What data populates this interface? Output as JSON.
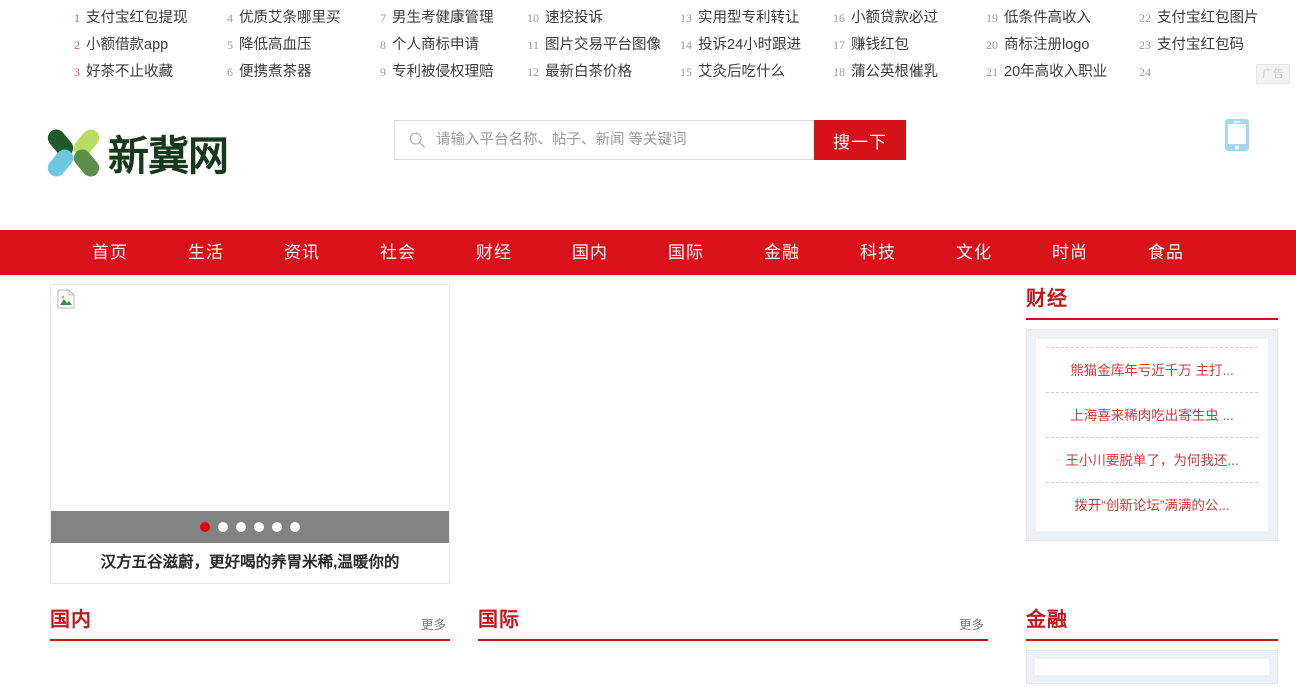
{
  "topbar": {
    "ad_badge": "广告",
    "keywords": [
      {
        "num": "1",
        "text": "支付宝红包提现"
      },
      {
        "num": "2",
        "text": "小额借款app"
      },
      {
        "num": "3",
        "text": "好茶不止收藏"
      },
      {
        "num": "4",
        "text": "优质艾条哪里买"
      },
      {
        "num": "5",
        "text": "降低高血压"
      },
      {
        "num": "6",
        "text": "便携煮茶器"
      },
      {
        "num": "7",
        "text": "男生考健康管理"
      },
      {
        "num": "8",
        "text": "个人商标申请"
      },
      {
        "num": "9",
        "text": "专利被侵权理赔"
      },
      {
        "num": "10",
        "text": "速挖投诉"
      },
      {
        "num": "11",
        "text": "图片交易平台图像"
      },
      {
        "num": "12",
        "text": "最新白茶价格"
      },
      {
        "num": "13",
        "text": "实用型专利转让"
      },
      {
        "num": "14",
        "text": "投诉24小时跟进"
      },
      {
        "num": "15",
        "text": "艾灸后吃什么"
      },
      {
        "num": "16",
        "text": "小额贷款必过"
      },
      {
        "num": "17",
        "text": "赚钱红包"
      },
      {
        "num": "18",
        "text": "蒲公英根催乳"
      },
      {
        "num": "19",
        "text": "低条件高收入"
      },
      {
        "num": "20",
        "text": "商标注册logo"
      },
      {
        "num": "21",
        "text": "20年高收入职业"
      },
      {
        "num": "22",
        "text": "支付宝红包图片"
      },
      {
        "num": "23",
        "text": "支付宝红包码"
      },
      {
        "num": "24",
        "text": ""
      }
    ]
  },
  "header": {
    "logo_text": "新冀网",
    "search": {
      "placeholder": "请输入平台名称、帖子、新闻 等关键词",
      "value": "",
      "button_label": "搜一下"
    },
    "mobile_icon": "mobile-phone-icon"
  },
  "nav": {
    "items": [
      {
        "label": "首页"
      },
      {
        "label": "生活"
      },
      {
        "label": "资讯"
      },
      {
        "label": "社会"
      },
      {
        "label": "财经"
      },
      {
        "label": "国内"
      },
      {
        "label": "国际"
      },
      {
        "label": "金融"
      },
      {
        "label": "科技"
      },
      {
        "label": "文化"
      },
      {
        "label": "时尚"
      },
      {
        "label": "食品"
      }
    ]
  },
  "slider": {
    "caption": "汉方五谷滋蔚，更好喝的养胃米稀,温暖你的",
    "dots": 6,
    "active_dot": 0
  },
  "sidebar": {
    "finance_news": {
      "title": "财经",
      "items": [
        {
          "text": "熊猫金库年亏近千万 主打..."
        },
        {
          "text": "上海喜来稀肉吃出寄生虫   ..."
        },
        {
          "text": "王小川要脱单了，为何我还..."
        },
        {
          "text": "拨开“创新论坛”满满的公..."
        }
      ]
    },
    "finance": {
      "title": "金融"
    }
  },
  "sections": {
    "domestic": {
      "title": "国内",
      "more": "更多"
    },
    "international": {
      "title": "国际",
      "more": "更多"
    }
  },
  "colors": {
    "brand_red": "#d9111a",
    "accent_red": "#c3171b",
    "link_red": "#cf3b3b",
    "logo_dark_green": "#1d5b2a",
    "logo_light_green": "#b9dd62",
    "logo_blue": "#6ec6e0",
    "logo_mid_green": "#5e8f4a"
  }
}
